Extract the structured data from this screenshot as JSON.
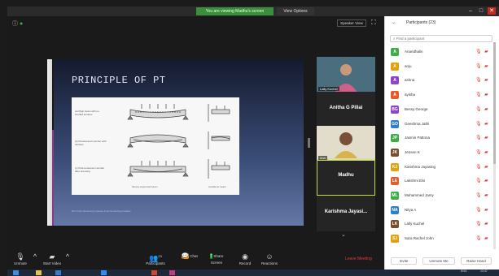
{
  "window": {
    "share_banner": "You are viewing Madhu's screen",
    "view_options": "View Options",
    "minimize": "–",
    "maximize": "□",
    "close": "✕"
  },
  "meeting": {
    "speaker_view": "Speaker View",
    "slide": {
      "title": "PRINCIPLE OF PT",
      "rows": [
        "(a) Plain beam with no bonded tendons",
        "(b) Prestressed member with tendons",
        "(c) Post-tensioned member after stressing"
      ],
      "captions": [
        "Simply supported beam",
        "Cantilever beam"
      ],
      "footer": "Ref: Post-Tensioning manual, Post-Tensioning Institute"
    },
    "video_tiles": [
      {
        "name": "Lally Kuchel",
        "type": "photo"
      },
      {
        "name": "Anitha G Pillai",
        "type": "name"
      },
      {
        "name": "Ann",
        "type": "photo"
      },
      {
        "name": "Madhu",
        "type": "name",
        "active": true
      },
      {
        "name": "Karishma Jayasi...",
        "type": "name"
      }
    ]
  },
  "toolbar": {
    "unmute": "Unmute",
    "start_video": "Start Video",
    "participants": "Participants",
    "participants_count": "23",
    "chat": "Chat",
    "share_screen": "Share Screen",
    "record": "Record",
    "reactions": "Reactions",
    "leave": "Leave Meeting"
  },
  "panel": {
    "title": "Participants (23)",
    "search_placeholder": "Find a participant",
    "participants": [
      {
        "initial": "A",
        "name": "Anandhalin",
        "color": "#3fae49"
      },
      {
        "initial": "A",
        "name": "anju",
        "color": "#e5a10b"
      },
      {
        "initial": "A",
        "name": "ashna",
        "color": "#8e44c4"
      },
      {
        "initial": "A",
        "name": "ayisha",
        "color": "#e35d2b"
      },
      {
        "initial": "BG",
        "name": "Bessy George",
        "color": "#8e44c4"
      },
      {
        "initial": "GO",
        "name": "Geeshma Jathi",
        "color": "#2d7fc7"
      },
      {
        "initial": "JP",
        "name": "Jasmin Pattona",
        "color": "#3fae49"
      },
      {
        "initial": "JK",
        "name": "Jensen K",
        "color": "#7a4d2a"
      },
      {
        "initial": "KJ",
        "name": "Karishma Jayasing",
        "color": "#e5a10b"
      },
      {
        "initial": "LE",
        "name": "Lakshmi Elvi",
        "color": "#e35d2b"
      },
      {
        "initial": "ML",
        "name": "Muhammed Jamy",
        "color": "#3fae49"
      },
      {
        "initial": "NA",
        "name": "Nitya A",
        "color": "#2d7fc7"
      },
      {
        "initial": "LK",
        "name": "Lally Kuchel",
        "color": "#7a4d2a"
      },
      {
        "initial": "SJ",
        "name": "Sara Rachel John",
        "color": "#e5a10b"
      }
    ],
    "buttons": [
      "Invite",
      "Unmute Me",
      "Raise Hand"
    ]
  },
  "taskbar": {
    "lang": "ENG",
    "time": "13:47"
  }
}
